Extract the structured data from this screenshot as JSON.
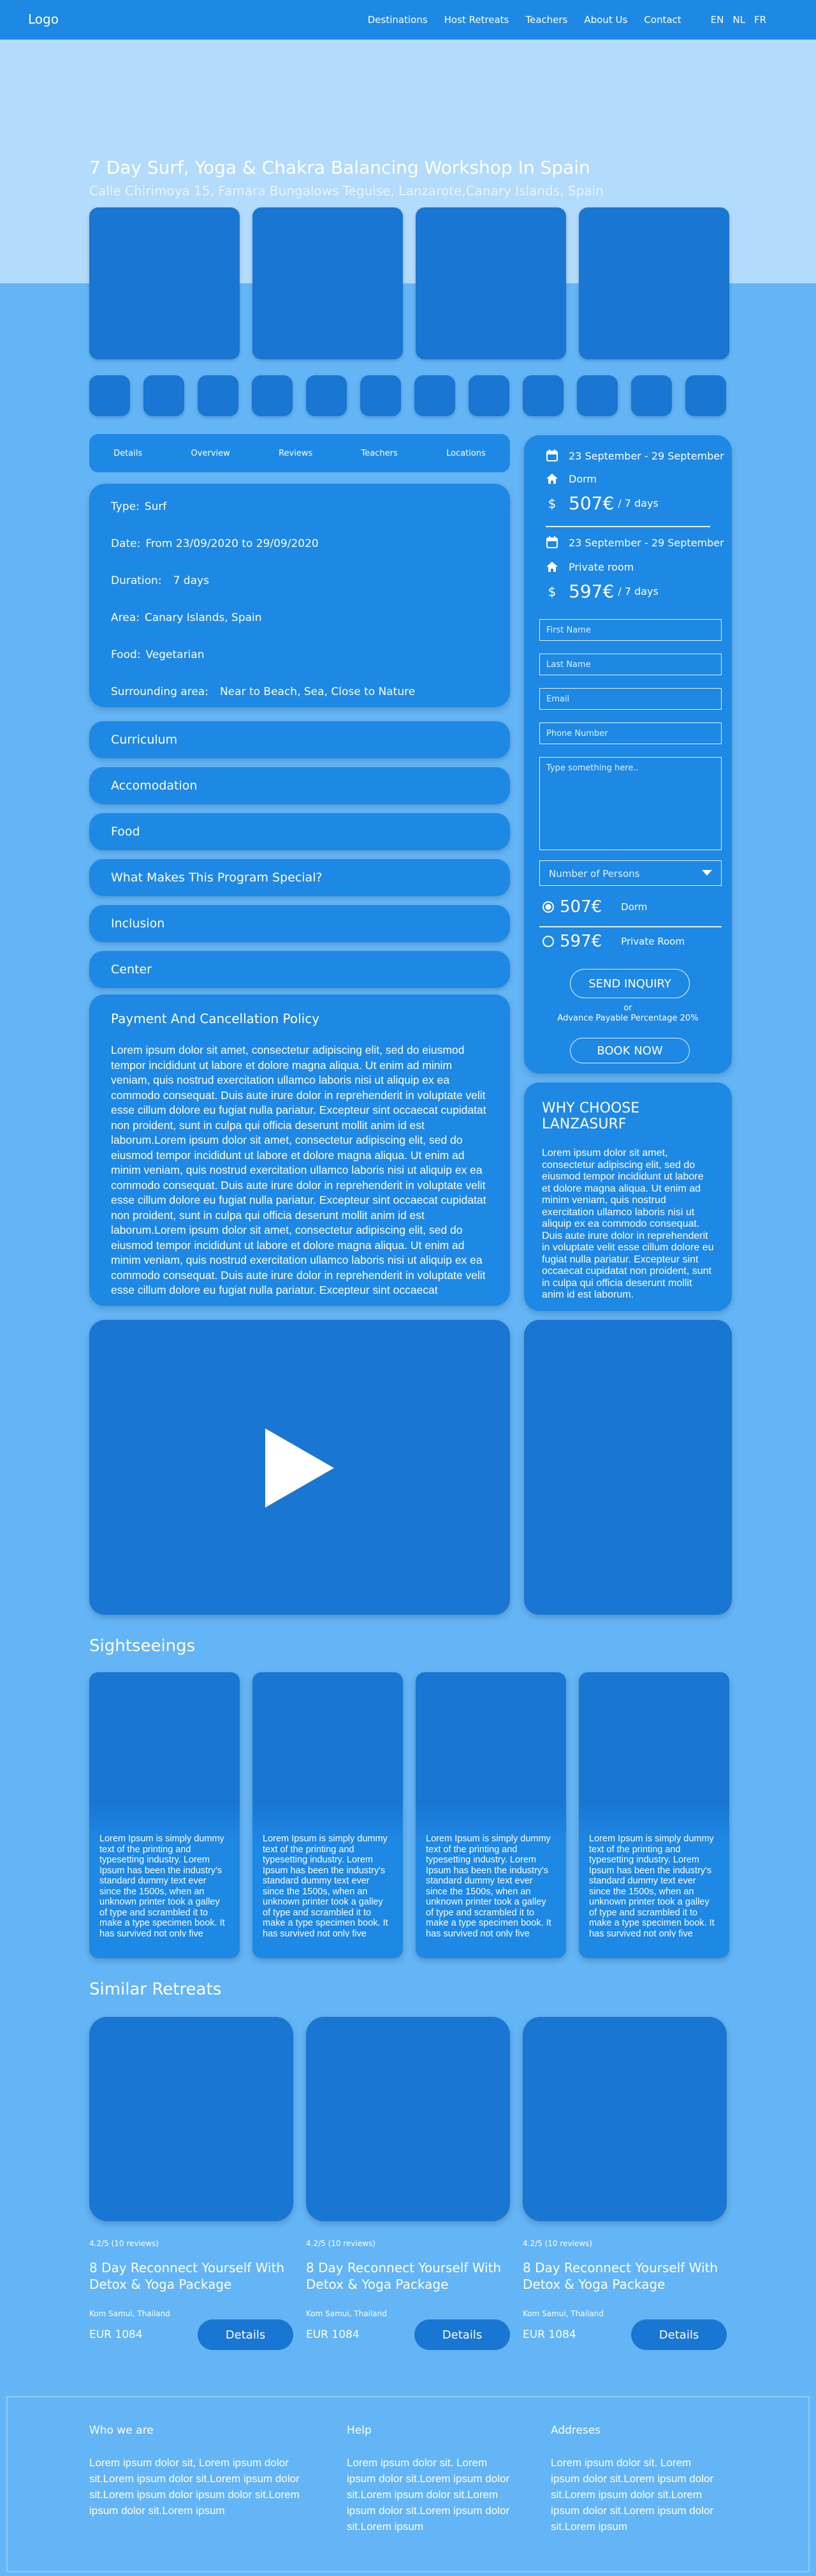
{
  "header": {
    "logo": "Logo",
    "nav": [
      "Destinations",
      "Host Retreats",
      "Teachers",
      "About Us",
      "Contact"
    ],
    "languages": [
      "EN",
      "NL",
      "FR"
    ]
  },
  "hero": {
    "title": "7 Day Surf, Yoga & Chakra Balancing Workshop In Spain",
    "address": "Calle Chirimoya 15, Famara Bungalows Teguise, Lanzarote,Canary Islands, Spain"
  },
  "tabs": [
    "Details",
    "Overview",
    "Reviews",
    "Teachers",
    "Locations"
  ],
  "details": {
    "type": {
      "label": "Type:",
      "value": "Surf"
    },
    "date": {
      "label": "Date:",
      "value": "From 23/09/2020 to 29/09/2020"
    },
    "duration": {
      "label": "Duration:",
      "value": "7 days"
    },
    "area": {
      "label": "Area:",
      "value": "Canary Islands, Spain"
    },
    "food": {
      "label": "Food:",
      "value": "Vegetarian"
    },
    "surrounding": {
      "label": "Surrounding area:",
      "value": "Near to Beach, Sea, Close to Nature"
    }
  },
  "accordions": [
    "Curriculum",
    "Accomodation",
    "Food",
    "What Makes This Program Special?",
    "Inclusion",
    "Center"
  ],
  "policy": {
    "title": "Payment And Cancellation Policy",
    "body": "Lorem ipsum dolor sit amet, consectetur adipiscing elit, sed do eiusmod tempor incididunt ut labore et dolore magna aliqua. Ut enim ad minim veniam, quis nostrud exercitation ullamco laboris nisi ut aliquip ex ea commodo consequat. Duis aute irure dolor in reprehenderit in voluptate velit esse cillum dolore eu fugiat nulla pariatur. Excepteur sint occaecat cupidatat non proident, sunt in culpa qui officia deserunt mollit anim id est laborum.Lorem ipsum dolor sit amet, consectetur adipiscing elit, sed do eiusmod tempor incididunt ut labore et dolore magna aliqua. Ut enim ad minim veniam, quis nostrud exercitation ullamco laboris nisi ut aliquip ex ea commodo consequat. Duis aute irure dolor in reprehenderit in voluptate velit esse cillum dolore eu fugiat nulla pariatur. Excepteur sint occaecat cupidatat non proident, sunt in culpa qui officia deserunt mollit anim id est laborum.Lorem ipsum dolor sit amet, consectetur adipiscing elit, sed do eiusmod tempor incididunt ut labore et dolore magna aliqua. Ut enim ad minim veniam, quis nostrud exercitation ullamco laboris nisi ut aliquip ex ea commodo consequat. Duis aute irure dolor in reprehenderit in voluptate velit esse cillum dolore eu fugiat nulla pariatur. Excepteur sint occaecat"
  },
  "booking": {
    "options": [
      {
        "dates": "23 September - 29 September",
        "room": "Dorm",
        "price": "507€",
        "per": "/ 7 days"
      },
      {
        "dates": "23 September - 29 September",
        "room": "Private room",
        "price": "597€",
        "per": "/ 7 days"
      }
    ],
    "form": {
      "first_name": "First Name",
      "last_name": "Last Name",
      "email": "Email",
      "phone": "Phone Number",
      "message": "Type something here.."
    },
    "persons_select": "Number of Persons",
    "radio_options": [
      {
        "price": "507€",
        "label": "Dorm",
        "selected": true
      },
      {
        "price": "597€",
        "label": "Private Room",
        "selected": false
      }
    ],
    "send_inquiry": "SEND INQUIRY",
    "or": "or",
    "advance": "Advance Payable Percentage 20%",
    "book_now": "BOOK NOW"
  },
  "why": {
    "title": "WHY CHOOSE LANZASURF",
    "body": "Lorem ipsum dolor sit amet, consectetur adipiscing elit, sed do eiusmod tempor incididunt ut labore et dolore magna aliqua. Ut enim ad minim veniam, quis nostrud exercitation ullamco laboris nisi ut aliquip ex ea commodo consequat. Duis aute irure dolor in reprehenderit in voluptate velit esse cillum dolore eu fugiat nulla pariatur. Excepteur sint occaecat cupidatat non proident, sunt in culpa qui officia deserunt mollit anim id est laborum."
  },
  "sightseeings": {
    "title": "Sightseeings",
    "items": [
      "Lorem Ipsum is simply dummy text of the printing and typesetting industry. Lorem Ipsum has been the industry's standard dummy text ever since the 1500s, when an unknown printer took a galley of type and scrambled it to make a type specimen book. It has survived not only five centuries, but also",
      "Lorem Ipsum is simply dummy text of the printing and typesetting industry. Lorem Ipsum has been the industry's standard dummy text ever since the 1500s, when an unknown printer took a galley of type and scrambled it to make a type specimen book. It has survived not only five centuries, but also",
      "Lorem Ipsum is simply dummy text of the printing and typesetting industry. Lorem Ipsum has been the industry's standard dummy text ever since the 1500s, when an unknown printer took a galley of type and scrambled it to make a type specimen book. It has survived not only five centuries, but also",
      "Lorem Ipsum is simply dummy text of the printing and typesetting industry. Lorem Ipsum has been the industry's standard dummy text ever since the 1500s, when an unknown printer took a galley of type and scrambled it to make a type specimen book. It has survived not only five centuries, but also"
    ]
  },
  "similar": {
    "title": "Similar Retreats",
    "items": [
      {
        "rating": "4.2/5 (10 reviews)",
        "title": "8 Day Reconnect Yourself With Detox & Yoga Package",
        "location": "Kom Samui, Thailand",
        "price": "EUR 1084",
        "button": "Details"
      },
      {
        "rating": "4.2/5 (10 reviews)",
        "title": "8 Day Reconnect Yourself With Detox & Yoga Package",
        "location": "Kom Samui, Thailand",
        "price": "EUR 1084",
        "button": "Details"
      },
      {
        "rating": "4.2/5 (10 reviews)",
        "title": "8 Day Reconnect Yourself With Detox & Yoga Package",
        "location": "Kom Samui, Thailand",
        "price": "EUR 1084",
        "button": "Details"
      }
    ]
  },
  "footer": {
    "columns": [
      {
        "title": "Who we are",
        "text": "Lorem ipsum dolor sit, Lorem ipsum dolor sit.Lorem ipsum dolor sit.Lorem ipsum dolor sit.Lorem ipsum dolor ipsum dolor sit.Lorem ipsum dolor sit.Lorem ipsum"
      },
      {
        "title": "Help",
        "text": "Lorem ipsum dolor sit. Lorem ipsum dolor sit.Lorem ipsum dolor sit.Lorem ipsum dolor sit.Lorem ipsum dolor sit.Lorem ipsum dolor sit.Lorem ipsum"
      },
      {
        "title": "Addreses",
        "text": "Lorem ipsum dolor sit. Lorem ipsum dolor sit.Lorem ipsum dolor sit.Lorem ipsum dolor sit.Lorem ipsum dolor sit.Lorem ipsum dolor sit.Lorem ipsum"
      }
    ]
  },
  "icons": {
    "calendar": "calendar-icon",
    "home": "home-icon",
    "dollar": "dollar-icon",
    "play": "play-icon",
    "chevron": "chevron-down-icon"
  },
  "colors": {
    "page_bg": "#64b5f6",
    "header_bg": "#1e88e5",
    "hero_bg": "#b3dbfc",
    "card_bg": "#1e88e5",
    "image_placeholder": "#1976d2"
  }
}
